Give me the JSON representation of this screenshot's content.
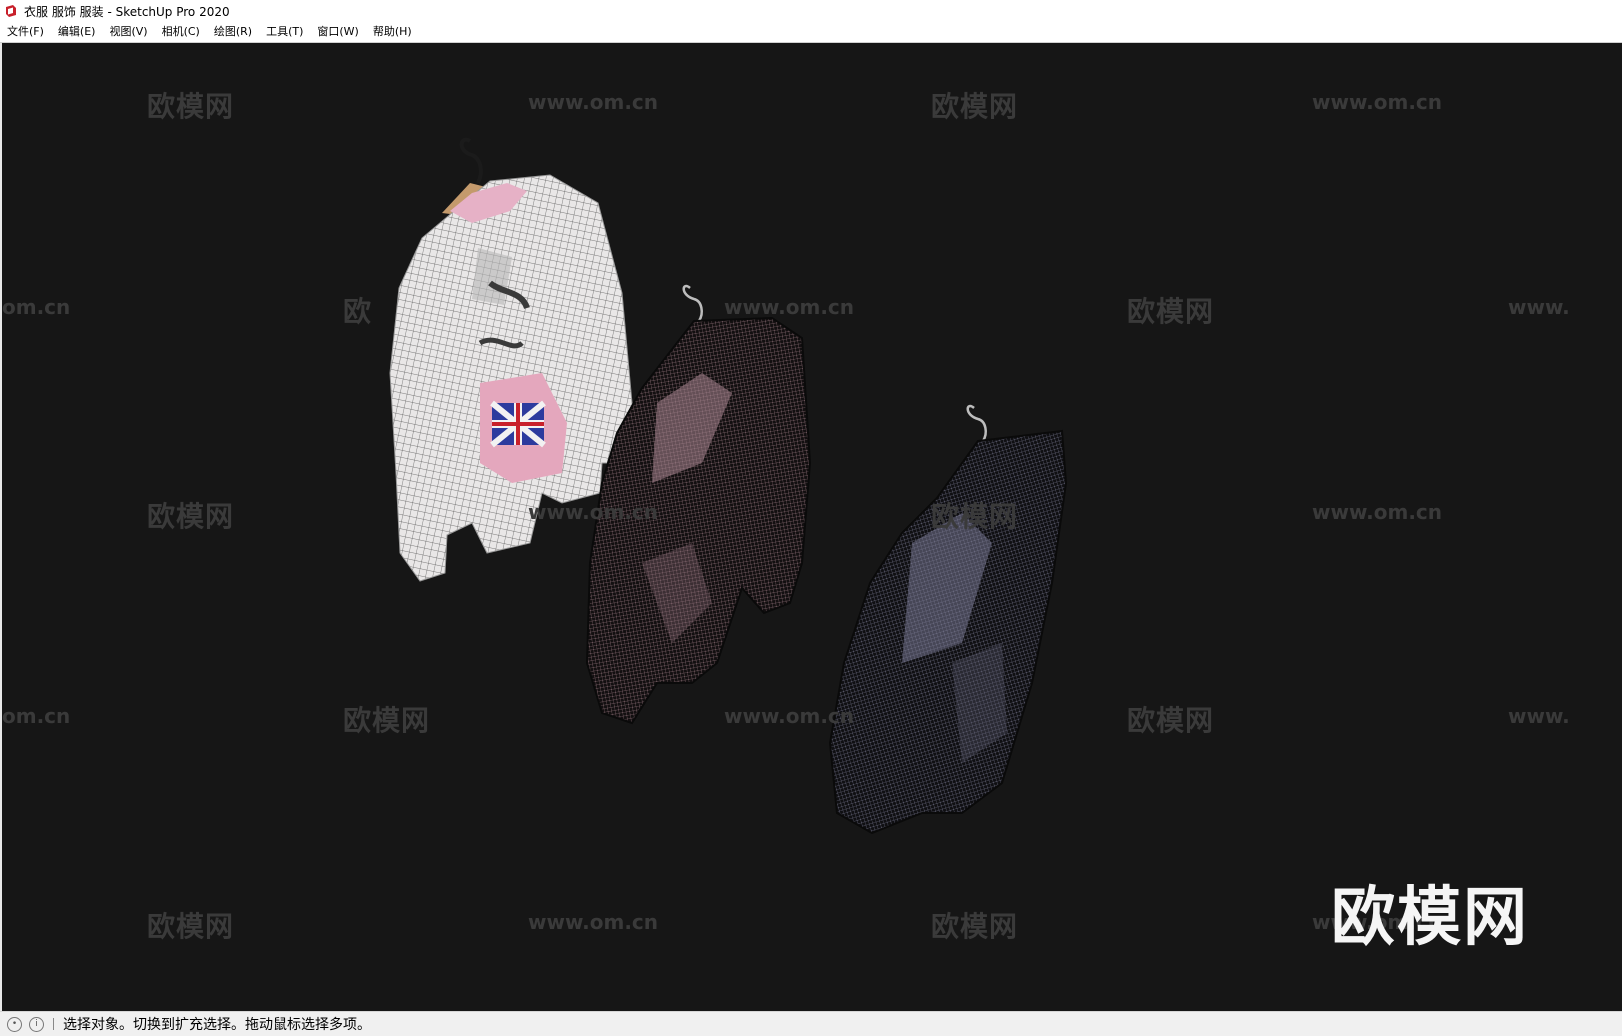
{
  "window": {
    "title": "衣服 服饰 服装 - SketchUp Pro 2020",
    "app_icon": "sketchup-icon",
    "accent": "#c8202b"
  },
  "menu": {
    "items": [
      {
        "label": "文件(F)"
      },
      {
        "label": "编辑(E)"
      },
      {
        "label": "视图(V)"
      },
      {
        "label": "相机(C)"
      },
      {
        "label": "绘图(R)"
      },
      {
        "label": "工具(T)"
      },
      {
        "label": "窗口(W)"
      },
      {
        "label": "帮助(H)"
      }
    ]
  },
  "viewport": {
    "background": "#161616",
    "watermark_text": "欧模网",
    "watermark_url": "www.om.cn",
    "watermark_url_cut": "om.cn",
    "watermark_url_cut_right": "www.",
    "watermark_text_cut": "欧",
    "brand_watermark": "欧模网",
    "garments": [
      {
        "name": "white-patterned-sweater",
        "color": "#e8e6e6"
      },
      {
        "name": "dark-pink-shirt",
        "color": "#4a3a3e"
      },
      {
        "name": "dark-blue-shirt",
        "color": "#2c2c34"
      }
    ]
  },
  "statusbar": {
    "icons": [
      "geo-location-icon",
      "info-icon"
    ],
    "message": "选择对象。切换到扩充选择。拖动鼠标选择多项。"
  }
}
